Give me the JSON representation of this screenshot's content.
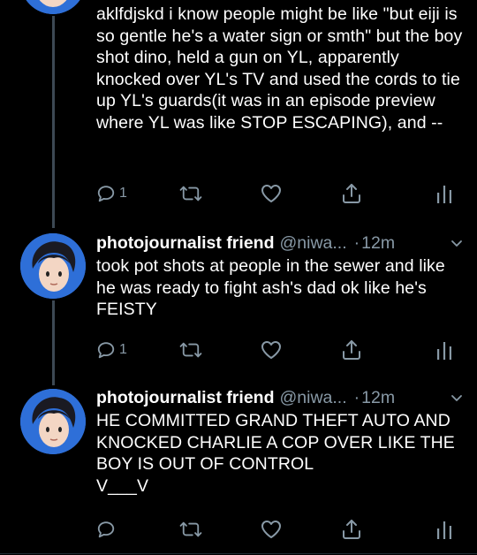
{
  "tweets": [
    {
      "text": "aklfdjskd i know people might be like \"but eiji is so gentle he's a water sign or smth\" but the boy shot dino, held a gun on YL, apparently knocked over YL's TV and used the cords to tie up YL's guards(it was in an episode preview where YL was like STOP ESCAPING), and --",
      "reply_count": "1"
    },
    {
      "name": "photojournalist friend",
      "handle": "@niwa...",
      "dot": "·",
      "time": "12m",
      "text": "took pot shots at people in the sewer and like he was ready to fight ash's dad ok like he's FEISTY",
      "reply_count": "1"
    },
    {
      "name": "photojournalist friend",
      "handle": "@niwa...",
      "dot": "·",
      "time": "12m",
      "text": "HE COMMITTED GRAND THEFT AUTO AND KNOCKED CHARLIE A COP OVER LIKE THE BOY IS OUT OF CONTROL\nV___V",
      "reply_count": ""
    }
  ],
  "icons": [
    "reply-icon",
    "retweet-icon",
    "like-icon",
    "share-icon",
    "analytics-icon",
    "chevron-down-icon"
  ],
  "colors": {
    "background": "#000000",
    "muted": "#8899a6",
    "thread_line": "#3d4954",
    "avatar_bg": "#2e6fd8"
  }
}
